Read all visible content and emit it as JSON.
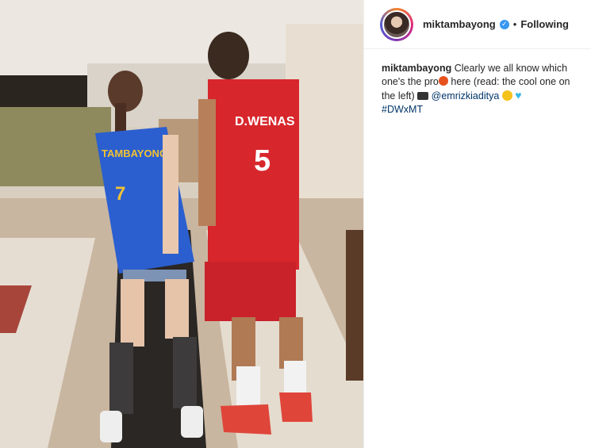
{
  "post": {
    "username": "miktambayong",
    "separator": "•",
    "follow_label": "Following",
    "caption": {
      "username": "miktambayong",
      "text_part1": "Clearly we all know which one's the pro",
      "text_part2": " here (read: the cool one on the left) ",
      "mention": "@emrizkiaditya",
      "hashtag": "#DWxMT"
    }
  },
  "photo": {
    "jersey_left": {
      "name": "TAMBAYONG",
      "number": "7",
      "color": "#2b5fd0"
    },
    "jersey_right": {
      "name": "D.WENAS",
      "number": "5",
      "color": "#d7262c"
    }
  },
  "icons": {
    "verified": "verified-check-icon",
    "basketball": "basketball-emoji-icon",
    "camera": "camera-emoji-icon",
    "face": "tongue-face-emoji-icon",
    "heart": "blue-heart-emoji-icon"
  }
}
